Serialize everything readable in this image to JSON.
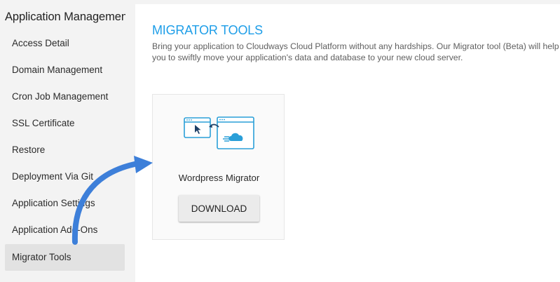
{
  "sidebar": {
    "title": "Application Management",
    "items": [
      {
        "label": "Access Detail"
      },
      {
        "label": "Domain Management"
      },
      {
        "label": "Cron Job Management"
      },
      {
        "label": "SSL Certificate"
      },
      {
        "label": "Restore"
      },
      {
        "label": "Deployment Via Git"
      },
      {
        "label": "Application Settings"
      },
      {
        "label": "Application Add-Ons"
      },
      {
        "label": "Migrator Tools",
        "active": true
      }
    ]
  },
  "main": {
    "title": "MIGRATOR TOOLS",
    "description": "Bring your application to Cloudways Cloud Platform without any hardships. Our Migrator tool (Beta) will help you to swiftly move your application's data and database to your new cloud server.",
    "tools": [
      {
        "name": "Wordpress Migrator",
        "icon": "migration-icon",
        "button_label": "DOWNLOAD"
      }
    ]
  },
  "colors": {
    "accent": "#1e9ee8",
    "annotation_arrow": "#3d7fd9",
    "active_nav_bg": "#e2e2e2"
  }
}
